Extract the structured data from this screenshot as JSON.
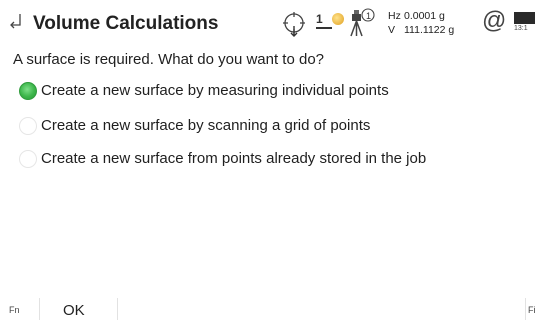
{
  "header": {
    "title": "Volume Calculations",
    "back_icon": "back-arrow-icon"
  },
  "status": {
    "gps_icon": "gps-crosshair-icon",
    "satellites": "1",
    "satellite_icon": "satellite-icon",
    "instrument_icon": "instrument-1-icon",
    "hz_label": "Hz",
    "hz_value": "0.0001 g",
    "v_label": "V",
    "v_value": "111.1122 g",
    "at_symbol": "@",
    "battery_icon": "battery-icon",
    "time": "13:1"
  },
  "prompt": {
    "question": "A surface is required. What do you want to do?"
  },
  "options": [
    {
      "label": "Create a new surface by measuring individual points",
      "selected": true
    },
    {
      "label": "Create a new surface by scanning a grid of points",
      "selected": false
    },
    {
      "label": "Create a new surface from points already stored in the job",
      "selected": false
    }
  ],
  "footer": {
    "fn_left": "Fn",
    "ok_label": "OK",
    "fn_right": "Fi"
  },
  "colors": {
    "selected_radio": "#3cb54a",
    "background": "#ffffff"
  }
}
